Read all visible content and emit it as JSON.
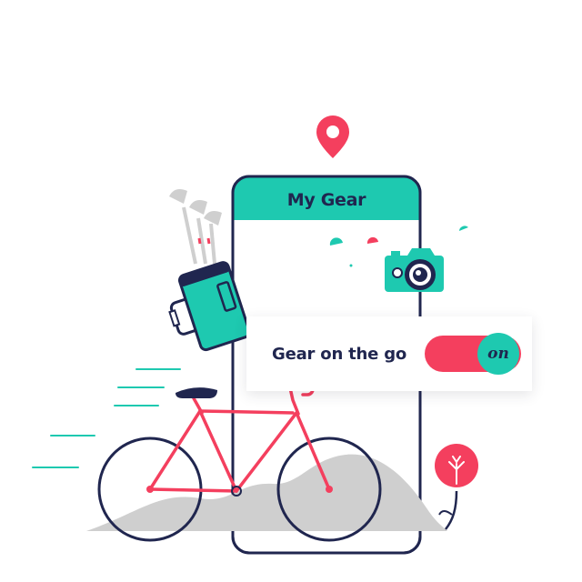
{
  "phone": {
    "title": "My Gear"
  },
  "toggle": {
    "label": "Gear on the go",
    "state_text": "on",
    "is_on": true
  },
  "colors": {
    "navy": "#20264f",
    "teal": "#1ec9b0",
    "coral": "#f43f5e",
    "grey": "#cfcfcf"
  },
  "icons": [
    "location-pin-icon",
    "camera-icon",
    "golf-bag-icon",
    "bicycle-icon",
    "flower-icon"
  ]
}
